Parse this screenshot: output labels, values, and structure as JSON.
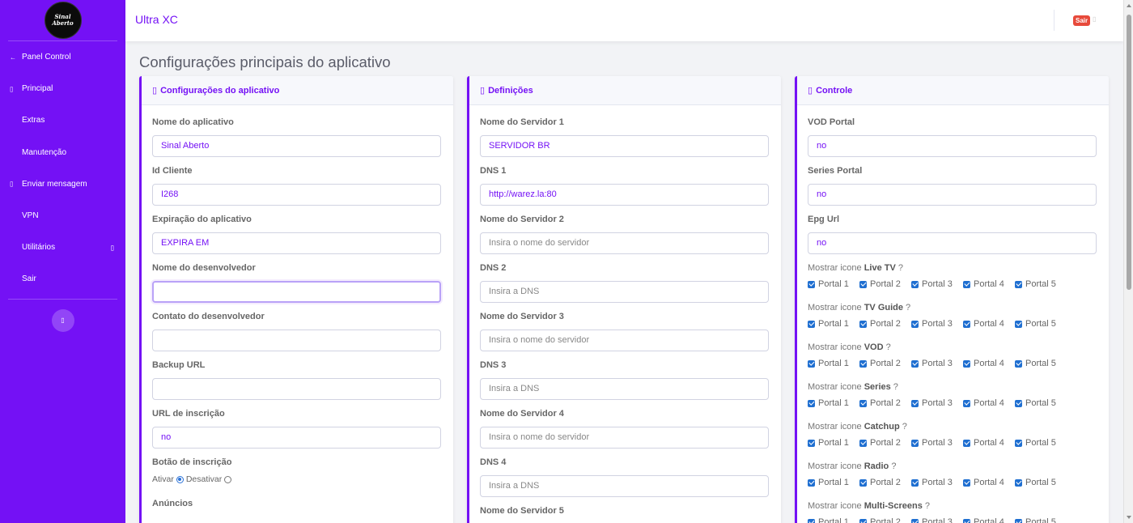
{
  "sidebar": {
    "logo_line1": "Sinal",
    "logo_line2": "Aberto",
    "items": [
      {
        "label": "Panel Control",
        "icon": "←"
      },
      {
        "label": "Principal",
        "icon": "▯"
      },
      {
        "label": "Extras",
        "icon": ""
      },
      {
        "label": "Manutenção",
        "icon": ""
      },
      {
        "label": "Enviar mensagem",
        "icon": "▯"
      },
      {
        "label": "VPN",
        "icon": ""
      },
      {
        "label": "Utilitários",
        "icon": "",
        "caret": "▯"
      },
      {
        "label": "Sair",
        "icon": ""
      }
    ],
    "toggle_icon": "▯"
  },
  "topbar": {
    "brand": "Ultra XC",
    "logout_label": "Sair",
    "logout_icon": "▯"
  },
  "page": {
    "title": "Configurações principais do aplicativo"
  },
  "app_config": {
    "header_icon": "▯",
    "header": "Configurações do aplicativo",
    "fields": [
      {
        "label": "Nome do aplicativo",
        "value": "Sinal Aberto",
        "placeholder": ""
      },
      {
        "label": "Id Cliente",
        "value": "I268",
        "placeholder": ""
      },
      {
        "label": "Expiração do aplicativo",
        "value": "EXPIRA EM",
        "placeholder": ""
      },
      {
        "label": "Nome do desenvolvedor",
        "value": "",
        "placeholder": ""
      },
      {
        "label": "Contato do desenvolvedor",
        "value": "",
        "placeholder": ""
      },
      {
        "label": "Backup URL",
        "value": "",
        "placeholder": ""
      },
      {
        "label": "URL de inscrição",
        "value": "no",
        "placeholder": ""
      }
    ],
    "signup_button_label": "Botão de inscrição",
    "radio_on_label": "Ativar",
    "radio_off_label": "Desativar",
    "ads_label": "Anúncios"
  },
  "definitions": {
    "header_icon": "▯",
    "header": "Definições",
    "fields": [
      {
        "label": "Nome do Servidor 1",
        "value": "SERVIDOR  BR",
        "placeholder": "Insira o nome do servidor"
      },
      {
        "label": "DNS 1",
        "value": "http://warez.la:80",
        "placeholder": "Insira a DNS"
      },
      {
        "label": "Nome do Servidor 2",
        "value": "",
        "placeholder": "Insira o nome do servidor"
      },
      {
        "label": "DNS 2",
        "value": "",
        "placeholder": "Insira a DNS"
      },
      {
        "label": "Nome do Servidor 3",
        "value": "",
        "placeholder": "Insira o nome do servidor"
      },
      {
        "label": "DNS 3",
        "value": "",
        "placeholder": "Insira a DNS"
      },
      {
        "label": "Nome do Servidor 4",
        "value": "",
        "placeholder": "Insira o nome do servidor"
      },
      {
        "label": "DNS 4",
        "value": "",
        "placeholder": "Insira a DNS"
      },
      {
        "label": "Nome do Servidor 5",
        "value": "",
        "placeholder": ""
      }
    ]
  },
  "control": {
    "header_icon": "▯",
    "header": "Controle",
    "fields": [
      {
        "label": "VOD Portal",
        "value": "no"
      },
      {
        "label": "Series Portal",
        "value": "no"
      },
      {
        "label": "Epg Url",
        "value": "no"
      }
    ],
    "show_prefix": "Mostrar icone",
    "show_suffix": "?",
    "portals": [
      "Portal 1",
      "Portal 2",
      "Portal 3",
      "Portal 4",
      "Portal 5"
    ],
    "groups": [
      "Live TV",
      "TV Guide",
      "VOD",
      "Series",
      "Catchup",
      "Radio",
      "Multi-Screens"
    ]
  }
}
